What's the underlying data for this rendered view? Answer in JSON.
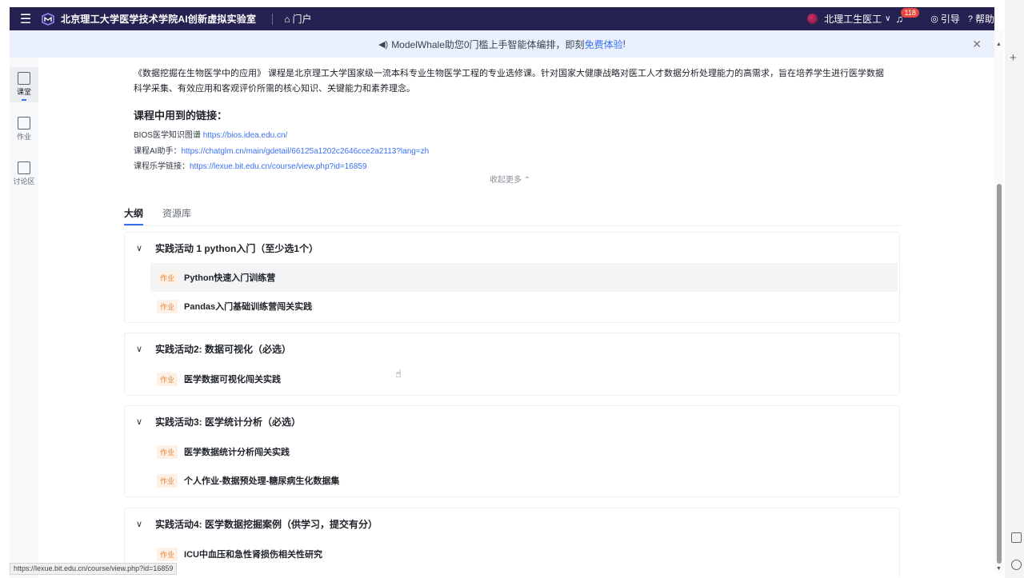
{
  "topbar": {
    "brand": "北京理工大学医学技术学院AI创新虚拟实验室",
    "portal": "门户",
    "org": "北理工生医工",
    "notification_count": "118",
    "guide": "引导",
    "help": "帮助"
  },
  "announcement": {
    "text_before": "ModelWhale助您0门槛上手智能体编排，即刻",
    "link": "免费体验",
    "text_after": "!"
  },
  "rail": {
    "items": [
      {
        "label": "课堂",
        "icon": "classroom-icon"
      },
      {
        "label": "作业",
        "icon": "homework-icon"
      },
      {
        "label": "讨论区",
        "icon": "discussion-icon"
      }
    ]
  },
  "course": {
    "description": "《数据挖掘在生物医学中的应用》 课程是北京理工大学国家级一流本科专业生物医学工程的专业选修课。针对国家大健康战略对医工人才数据分析处理能力的高需求，旨在培养学生进行医学数据科学采集、有效应用和客观评价所需的核心知识、关键能力和素养理念。",
    "links_title": "课程中用到的链接：",
    "links": [
      {
        "label": "BIOS医学知识图谱 ",
        "url": "https://bios.idea.edu.cn/"
      },
      {
        "label": "课程AI助手：",
        "url": "https://chatglm.cn/main/gdetail/66125a1202c2646cce2a2113?lang=zh"
      },
      {
        "label": "课程乐学链接：",
        "url": "https://lexue.bit.edu.cn/course/view.php?id=16859"
      }
    ],
    "collapse": "收起更多 ⌃"
  },
  "tabs": [
    "大纲",
    "资源库"
  ],
  "sections": [
    {
      "title": "实践活动 1 python入门（至少选1个）",
      "items": [
        {
          "tag": "作业",
          "name": "Python快速入门训练营"
        },
        {
          "tag": "作业",
          "name": "Pandas入门基础训练营闯关实践"
        }
      ]
    },
    {
      "title": "实践活动2: 数据可视化（必选）",
      "items": [
        {
          "tag": "作业",
          "name": "医学数据可视化闯关实践"
        }
      ]
    },
    {
      "title": "实践活动3: 医学统计分析（必选）",
      "items": [
        {
          "tag": "作业",
          "name": "医学数据统计分析闯关实践"
        },
        {
          "tag": "作业",
          "name": "个人作业-数据预处理-糖尿病生化数据集"
        }
      ]
    },
    {
      "title": "实践活动4: 医学数据挖掘案例（供学习，提交有分）",
      "items": [
        {
          "tag": "作业",
          "name": "ICU中血压和急性肾损伤相关性研究"
        }
      ]
    }
  ],
  "status_url": "https://lexue.bit.edu.cn/course/view.php?id=16859"
}
